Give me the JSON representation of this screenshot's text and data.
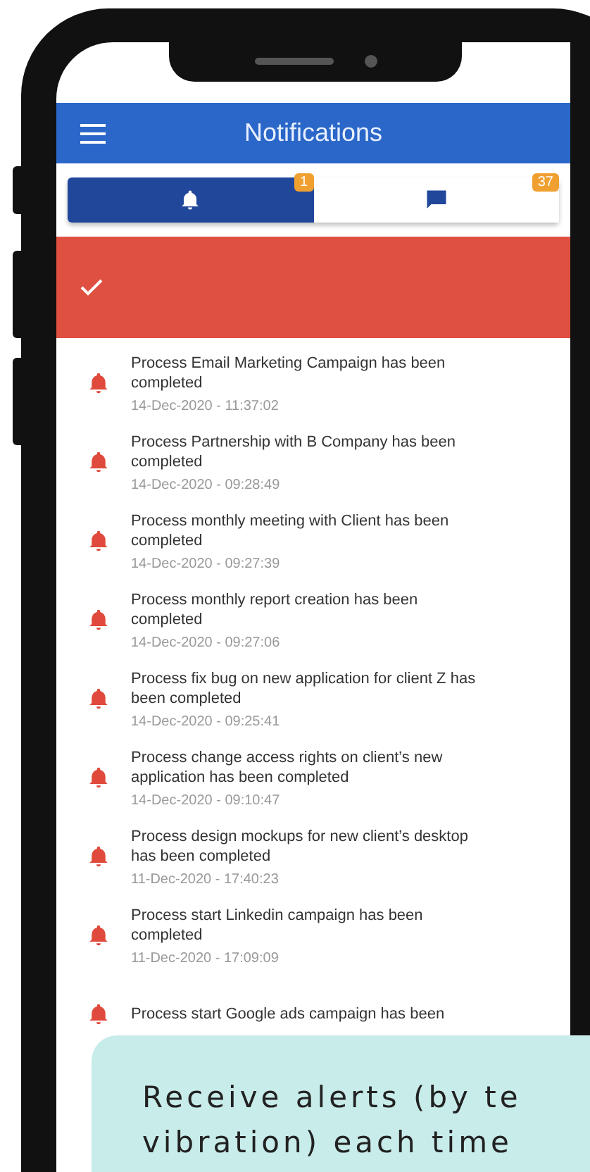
{
  "header": {
    "title": "Notifications"
  },
  "tabs": [
    {
      "kind": "bell",
      "badge": "1",
      "selected": true
    },
    {
      "kind": "chat",
      "badge": "37",
      "selected": false
    }
  ],
  "notifications": [
    {
      "text": "Process Email Marketing Campaign has been completed",
      "time": "14-Dec-2020 - 11:37:02"
    },
    {
      "text": "Process Partnership with B Company has been completed",
      "time": "14-Dec-2020 - 09:28:49"
    },
    {
      "text": "Process monthly meeting with Client has been completed",
      "time": "14-Dec-2020 - 09:27:39"
    },
    {
      "text": "Process monthly report creation has been completed",
      "time": "14-Dec-2020 - 09:27:06"
    },
    {
      "text": "Process fix bug on new application for client Z has been completed",
      "time": "14-Dec-2020 - 09:25:41"
    },
    {
      "text": "Process change access rights on client’s new application has been completed",
      "time": "14-Dec-2020 - 09:10:47"
    },
    {
      "text": "Process design mockups for new client’s desktop has been completed",
      "time": "11-Dec-2020 - 17:40:23"
    },
    {
      "text": "Process start Linkedin campaign has been completed",
      "time": "11-Dec-2020 - 17:09:09"
    },
    {
      "text": "Process start Google ads campaign has been"
    }
  ],
  "callout": {
    "lines": [
      "Receive alerts (by te",
      "vibration) each time"
    ]
  }
}
